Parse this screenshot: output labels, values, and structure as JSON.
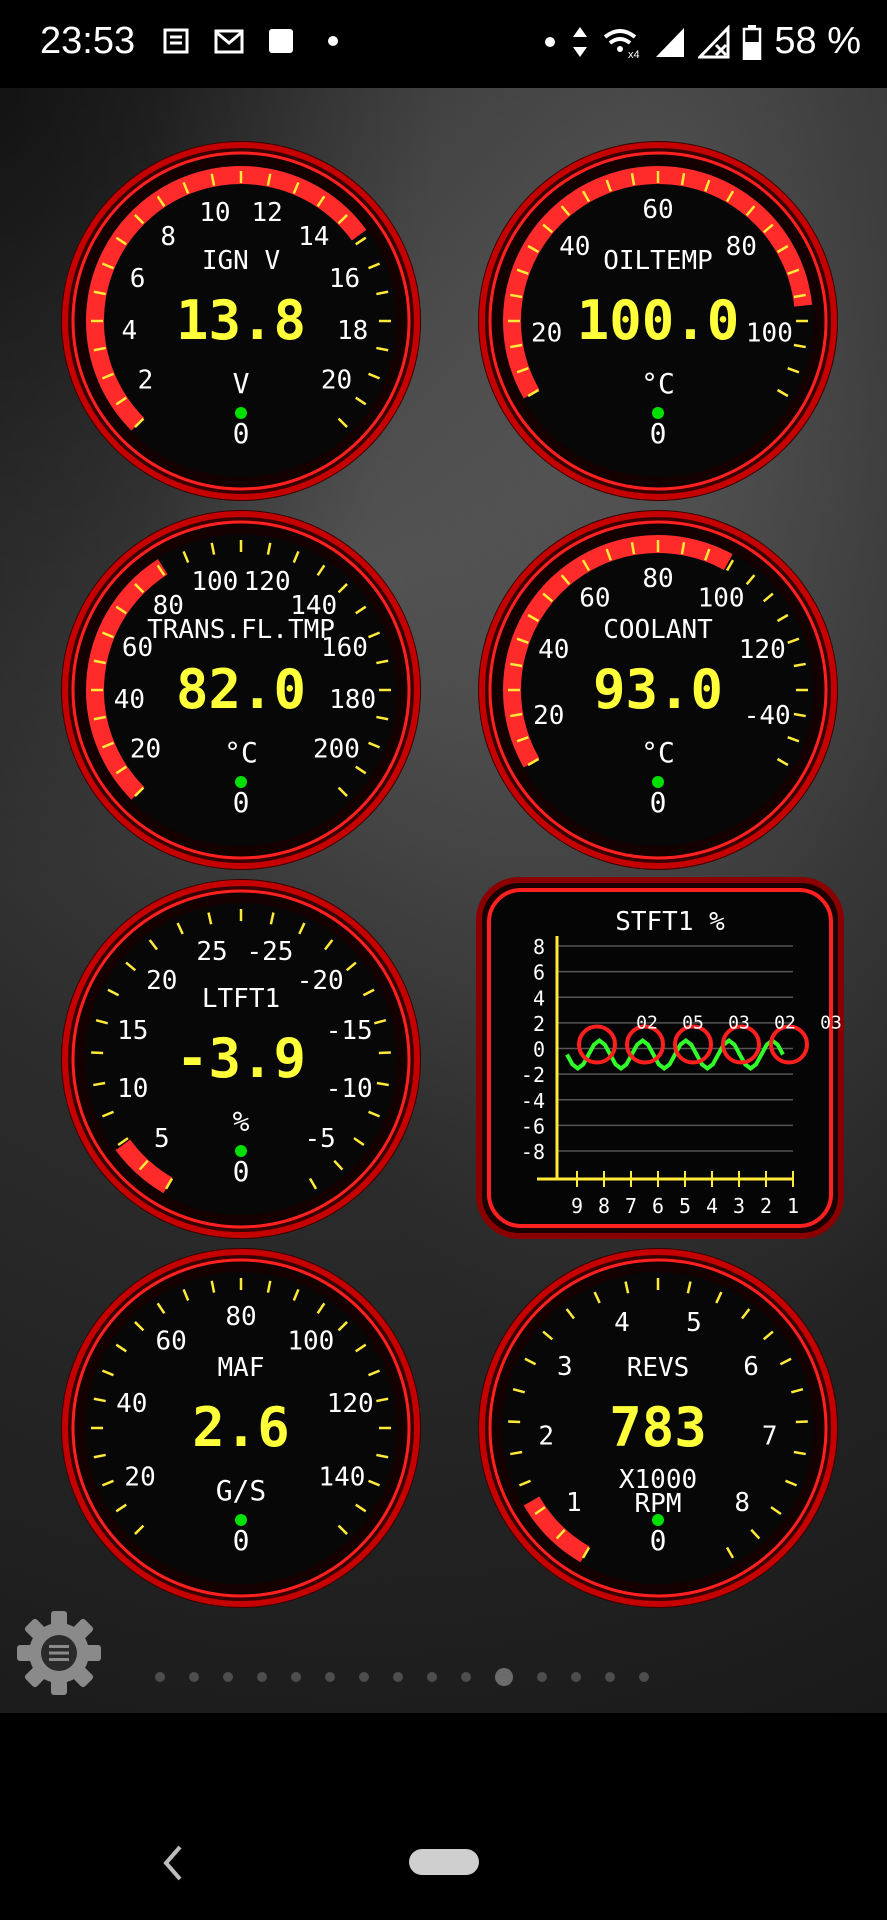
{
  "status_bar": {
    "time": "23:53",
    "left_icons": [
      "news-icon",
      "gmail-icon",
      "square-icon",
      "dot-icon"
    ],
    "right_icons": [
      "dot-icon",
      "data-arrows-icon",
      "wifi-x4-icon",
      "signal-icon",
      "signal-x-icon",
      "battery-icon"
    ],
    "battery": "58 %"
  },
  "gauges": [
    {
      "id": "ign-v",
      "label": "IGN V",
      "value": "13.8",
      "unit": "V",
      "zero": "0",
      "ticks": [
        "2",
        "4",
        "6",
        "8",
        "10",
        "12",
        "14",
        "16",
        "18",
        "20"
      ],
      "level_fraction": 0.7
    },
    {
      "id": "oil-temp",
      "label": "OILTEMP",
      "value": "100.0",
      "unit": "°C",
      "zero": "0",
      "ticks": [
        "20",
        "40",
        "60",
        "80",
        "100"
      ],
      "level_fraction": 0.85
    },
    {
      "id": "trans-fl-tmp",
      "label": "TRANS.FL.TMP",
      "value": "82.0",
      "unit": "°C",
      "zero": "0",
      "ticks": [
        "20",
        "40",
        "60",
        "80",
        "100",
        "120",
        "140",
        "160",
        "180",
        "200"
      ],
      "level_fraction": 0.38
    },
    {
      "id": "coolant",
      "label": "COOLANT",
      "value": "93.0",
      "unit": "°C",
      "zero": "0",
      "ticks": [
        "20",
        "40",
        "60",
        "80",
        "100",
        "120",
        "-40"
      ],
      "level_fraction": 0.62
    },
    {
      "id": "ltft1",
      "label": "LTFT1",
      "value": "-3.9",
      "unit": "%",
      "zero": "0",
      "ticks": [
        "5",
        "10",
        "15",
        "20",
        "25",
        "-25",
        "-20",
        "-15",
        "-10",
        "-5"
      ],
      "level_fraction": 0.08
    },
    {
      "id": "maf",
      "label": "MAF",
      "value": "2.6",
      "unit": "G/S",
      "zero": "0",
      "ticks": [
        "20",
        "40",
        "60",
        "80",
        "100",
        "120",
        "140"
      ],
      "level_fraction": 0.0
    },
    {
      "id": "revs",
      "label": "REVS",
      "value": "783",
      "unit": "X1000\nRPM",
      "unit_line1": "X1000",
      "unit_line2": "RPM",
      "zero": "0",
      "ticks": [
        "1",
        "2",
        "3",
        "4",
        "5",
        "6",
        "7",
        "8"
      ],
      "level_fraction": 0.1
    }
  ],
  "stft_chart": {
    "title": "STFT1  %",
    "y_ticks": [
      "8",
      "6",
      "4",
      "2",
      "0",
      "-2",
      "-4",
      "-6",
      "-8"
    ],
    "x_ticks": [
      "9",
      "8",
      "7",
      "6",
      "5",
      "4",
      "3",
      "2",
      "1"
    ],
    "right_labels": [
      "02",
      "05",
      "03",
      "02",
      "03"
    ]
  },
  "pager": {
    "count": 15,
    "active_index": 10
  },
  "colors": {
    "ring_red": "#ff2a2a",
    "value_yellow": "#ffff3a",
    "tick_yellow": "#ffea3a",
    "green_dot": "#00e000",
    "stft_green": "#31ff2a",
    "stft_red": "#ff1f1f"
  }
}
